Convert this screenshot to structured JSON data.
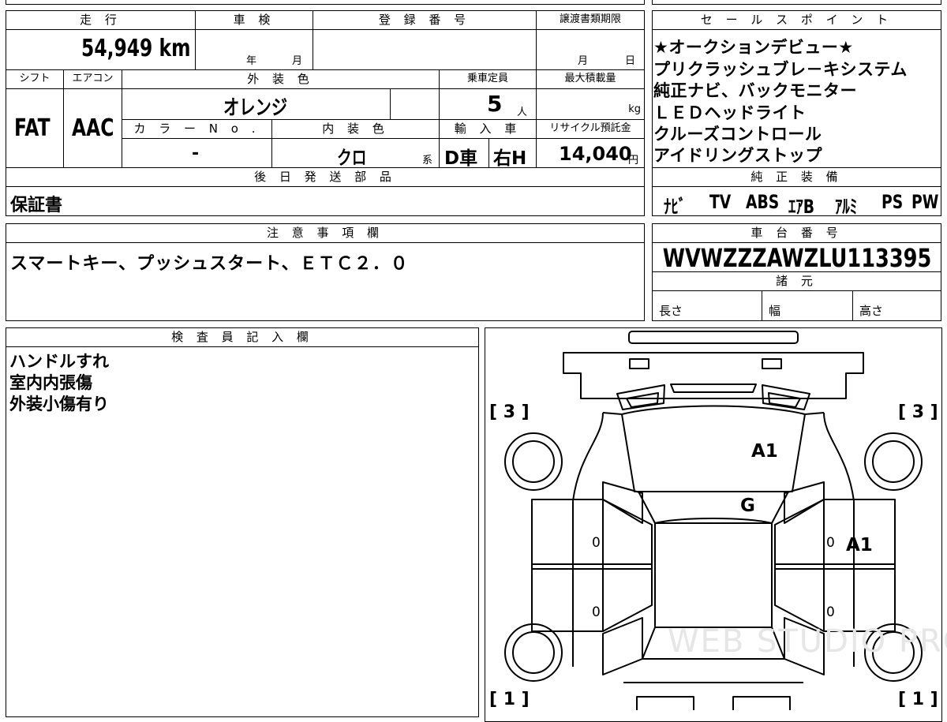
{
  "header": {
    "mileage_label": "走 行",
    "inspection_label": "車 検",
    "registration_label": "登 録 番 号",
    "transfer_deadline_label": "譲渡書類期限",
    "shift_label": "シフト",
    "aircon_label": "エアコン",
    "exterior_color_label": "外 装 色",
    "capacity_label": "乗車定員",
    "max_load_label": "最大積載量",
    "color_no_label": "カ ラ ー N o .",
    "interior_color_label": "内 装 色",
    "import_label": "輸 入 車",
    "recycle_label": "リサイクル預託金",
    "later_parts_label": "後 日 発 送 部 品",
    "sales_point_label": "セ ー ル ス ポ イ ン ト",
    "equipment_label": "純 正 装 備",
    "notes_label": "注 意 事 項 欄",
    "chassis_label": "車 台 番 号",
    "specs_label": "諸 元",
    "inspector_label": "検 査 員 記 入 欄"
  },
  "vehicle": {
    "mileage_value": "54,949",
    "mileage_unit": "km",
    "inspection_year_unit": "年",
    "inspection_month_unit": "月",
    "transfer_month_unit": "月",
    "transfer_day_unit": "日",
    "shift": "FAT",
    "aircon": "AAC",
    "exterior_color": "オレンジ",
    "capacity_value": "5",
    "capacity_unit": "人",
    "max_load_unit": "kg",
    "color_no": "-",
    "interior_color": "クロ",
    "interior_suffix": "系",
    "import_type": "D車",
    "handle_side": "右H",
    "recycle_value": "14,040",
    "recycle_unit": "円",
    "later_parts": "保証書",
    "chassis_number": "WVWZZZAWZLU113395",
    "length_label": "長さ",
    "width_label": "幅",
    "height_label": "高さ"
  },
  "sales_points": [
    "★オークションデビュー★",
    "プリクラッシュブレ－キシステム",
    "純正ナビ、バックモニター",
    "ＬＥＤヘッドライト",
    "クルーズコントロール",
    "アイドリングストップ"
  ],
  "equipment": [
    "ﾅﾋﾞ",
    "TV",
    "ABS",
    "ｴｱB",
    "ｱﾙﾐ",
    "PS",
    "PW"
  ],
  "notes": "スマートキー、プッシュスタート、ＥＴＣ２．０",
  "inspector_notes": [
    "ハンドルすれ",
    "室内内張傷",
    "外装小傷有り"
  ],
  "diagram": {
    "tire_front_left": "[ 3 ]",
    "tire_front_right": "[ 3 ]",
    "tire_rear_left": "[ 1 ]",
    "tire_rear_right": "[ 1 ]",
    "mark_hood": "A1",
    "mark_windshield": "G",
    "mark_right_front_door": "A1",
    "door_lf": "0",
    "door_lr": "0",
    "door_rf": "0",
    "door_rr": "0",
    "watermark": "WEB STUDIO PRO"
  }
}
